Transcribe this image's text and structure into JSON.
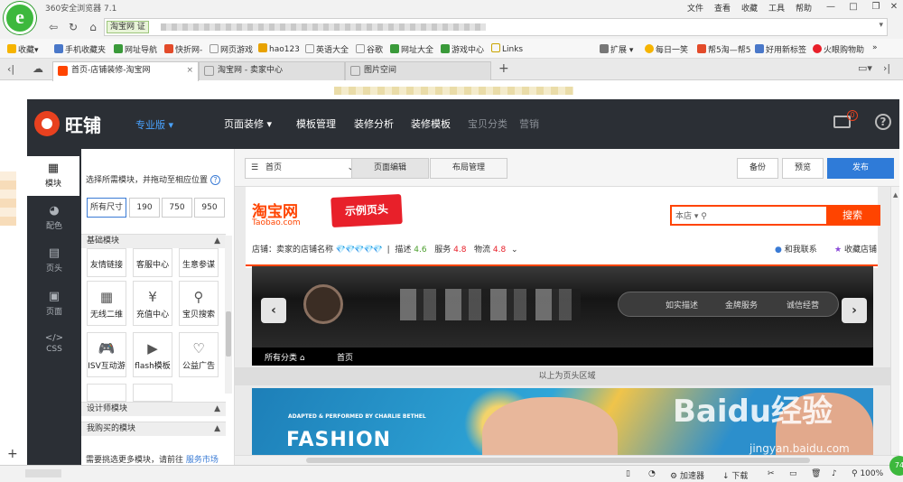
{
  "browser": {
    "title": "360安全浏览器 7.1",
    "menu": [
      "文件",
      "查看",
      "收藏",
      "工具",
      "帮助"
    ],
    "address_badge": "淘宝网",
    "address_badge_tag": "证",
    "favorites": [
      "收藏",
      "手机收藏夹",
      "网址导航",
      "快折网-",
      "网页游戏",
      "hao123",
      "英语大全",
      "谷歌",
      "网址大全",
      "游戏中心",
      "Links"
    ],
    "favorites_right": [
      "扩展",
      "每日一笑",
      "帮5淘—帮5",
      "好用新标签",
      "火眼购物助"
    ],
    "tabs": [
      {
        "label": "首页-店铺装修-淘宝网",
        "active": true
      },
      {
        "label": "淘宝网 - 卖家中心",
        "active": false
      },
      {
        "label": "图片空间",
        "active": false
      }
    ],
    "new_tab": "+"
  },
  "app": {
    "brand": "旺铺",
    "edition": "专业版",
    "nav": [
      {
        "label": "页面装修",
        "enabled": true
      },
      {
        "label": "模板管理",
        "enabled": true
      },
      {
        "label": "装修分析",
        "enabled": true
      },
      {
        "label": "装修模板",
        "enabled": true
      },
      {
        "label": "宝贝分类",
        "enabled": false
      },
      {
        "label": "营销",
        "enabled": false
      }
    ],
    "mail_count": "0",
    "help": "?"
  },
  "rail": [
    {
      "label": "模块",
      "icon": "grid-icon",
      "active": true
    },
    {
      "label": "配色",
      "icon": "palette-icon",
      "active": false
    },
    {
      "label": "页头",
      "icon": "header-icon",
      "active": false
    },
    {
      "label": "页面",
      "icon": "page-icon",
      "active": false
    },
    {
      "label": "CSS",
      "icon": "code-icon",
      "active": false
    }
  ],
  "module_panel": {
    "hint": "选择所需模块，并拖动至相应位置",
    "sizes": [
      "所有尺寸",
      "190",
      "750",
      "950"
    ],
    "basic_section": "基础模块",
    "modules": [
      "友情链接",
      "客服中心",
      "生意参谋",
      "无线二维",
      "充值中心",
      "宝贝搜索",
      "ISV互动游",
      "flash模板",
      "公益广告"
    ],
    "designer_section": "设计师模块",
    "purchased_section": "我购买的模块",
    "market_hint": "需要挑选更多模块，请前往",
    "market_link": "服务市场"
  },
  "toolbar": {
    "page_select": "首页",
    "tabs": [
      "页面编辑",
      "布局管理"
    ],
    "backup": "备份",
    "preview": "预览",
    "publish": "发布"
  },
  "shop": {
    "tb_logo": "淘宝网",
    "tb_domain": "Taobao.com",
    "sample_header": "示例页头",
    "search_scope": "本店",
    "search_button": "搜索",
    "shop_name_label": "店铺：卖家的店铺名称",
    "diamonds": "💎💎💎💎💎",
    "desc_label": "描述",
    "desc_value": "4.6",
    "service_label": "服务",
    "service_value": "4.8",
    "logistics_label": "物流",
    "logistics_value": "4.8",
    "contact": "和我联系",
    "favorite": "收藏店铺",
    "hero_tags": [
      "如实描述",
      "金牌服务",
      "诚信经营"
    ],
    "nav_all": "所有分类",
    "nav_home": "首页",
    "header_area_label": "以上为页头区域",
    "banner_small": "ADAPTED & PERFORMED BY CHARLIE BETHEL",
    "banner_title": "FASHION"
  },
  "watermark": {
    "text": "Baidu经验",
    "url": "jingyan.baidu.com"
  },
  "statusbar": {
    "accelerator": "加速器",
    "download": "下载",
    "zoom": "100%",
    "badge": "74"
  }
}
